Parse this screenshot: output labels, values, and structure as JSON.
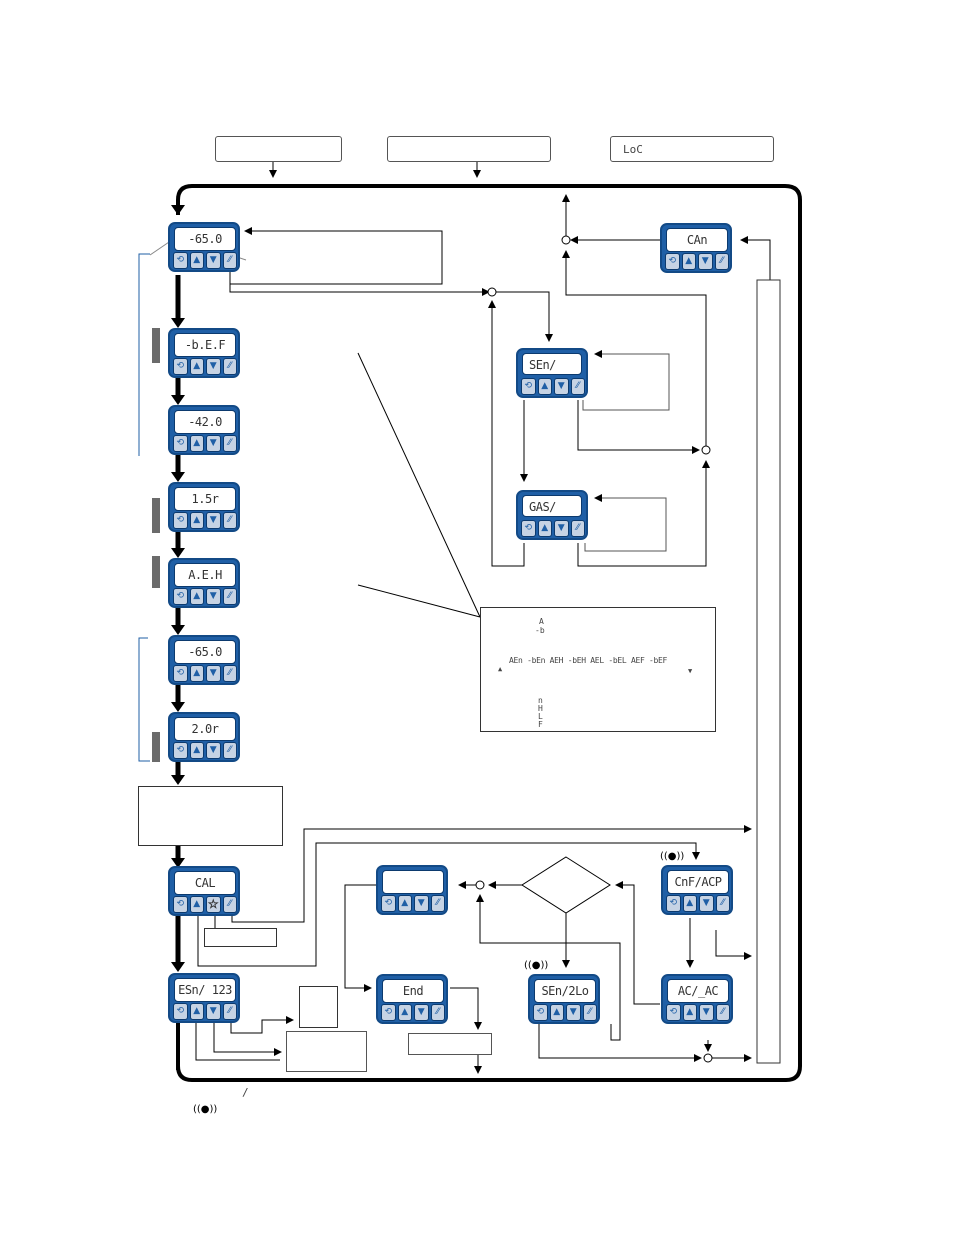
{
  "header": {
    "boxes": [
      {
        "id": "top-box-1",
        "text": ""
      },
      {
        "id": "top-box-2",
        "text": ""
      },
      {
        "id": "top-box-3",
        "text": "LoC"
      }
    ]
  },
  "devices": {
    "main_temp": "-65.0",
    "b_e_f": "-b.E.F",
    "temp_42": "-42.0",
    "time_15": "1.5r",
    "a_e_h": "A.E.H",
    "temp_65b": "-65.0",
    "time_20": "2.0r",
    "cal": "CAL",
    "sen_123": "ESn/ 123",
    "can": "CAn",
    "sen": "SEn/",
    "gas": "GAS/",
    "blank": "",
    "end": "End",
    "sen_2lo": "SEn/2Lo",
    "cnf_acp": "CnF/ACP",
    "ac_ac": "AC/_AC"
  },
  "buttons": {
    "b1": "⟲",
    "b2": "▲",
    "b3": "▼",
    "b4": "⁄⁄",
    "star": "☆"
  },
  "inset": {
    "top_labels": [
      "A",
      "-b"
    ],
    "sequence": "AEn -bEn AEH -bEH AEL -bEL AEF -bEF",
    "bottom_labels": [
      "n",
      "H",
      "L",
      "F"
    ],
    "up_symbol": "▲",
    "down_symbol": "▼"
  },
  "footer": {
    "slash_note": "/",
    "bell_symbol": "((●))"
  },
  "bells": {
    "cnf": "((●))",
    "sen2lo": "((●))"
  },
  "colors": {
    "device_blue": "#1f5fa6",
    "button_bg": "#c6d3e4",
    "frame": "#000000",
    "side_bar": "#6b6b6b"
  }
}
